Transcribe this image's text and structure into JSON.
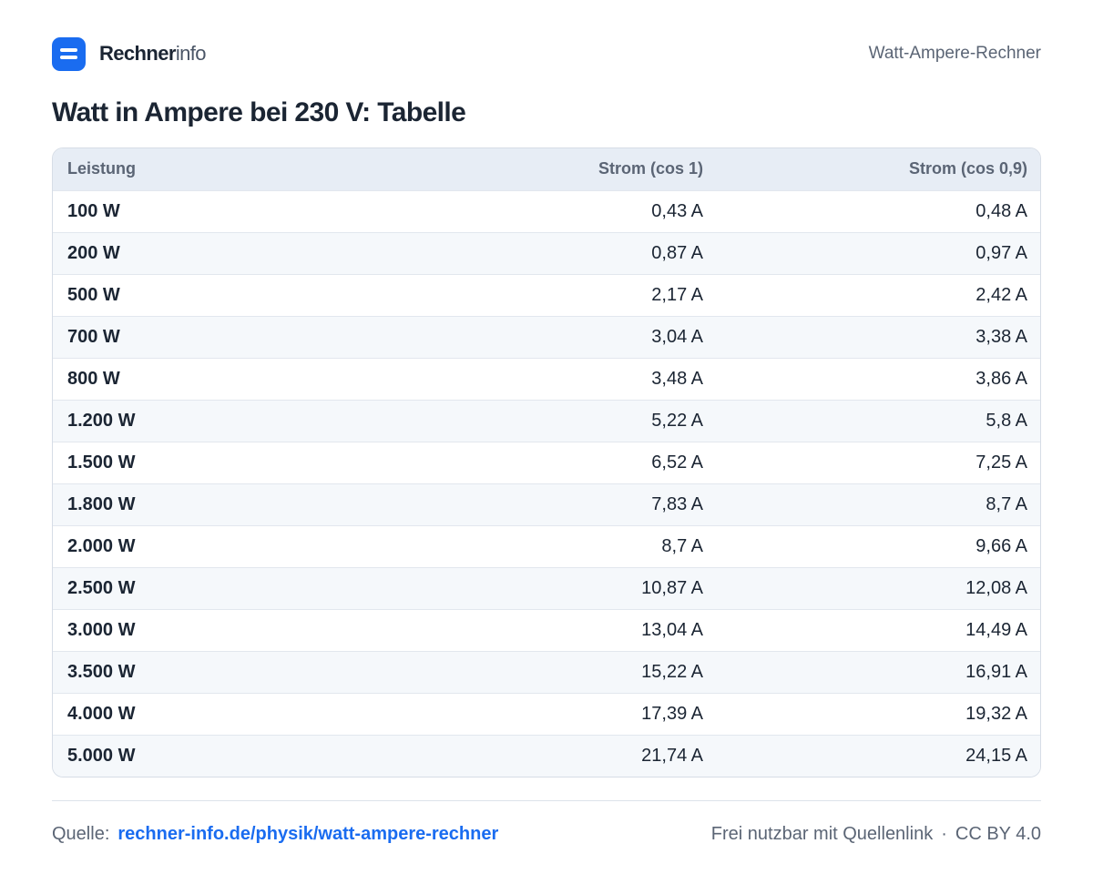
{
  "header": {
    "brand_strong": "Rechner",
    "brand_light": "info",
    "page_label": "Watt-Ampere-Rechner"
  },
  "title": "Watt in Ampere bei 230 V: Tabelle",
  "table": {
    "columns": [
      "Leistung",
      "Strom (cos  1)",
      "Strom (cos  0,9)"
    ],
    "rows": [
      [
        "100 W",
        "0,43 A",
        "0,48 A"
      ],
      [
        "200 W",
        "0,87 A",
        "0,97 A"
      ],
      [
        "500 W",
        "2,17 A",
        "2,42 A"
      ],
      [
        "700 W",
        "3,04 A",
        "3,38 A"
      ],
      [
        "800 W",
        "3,48 A",
        "3,86 A"
      ],
      [
        "1.200 W",
        "5,22 A",
        "5,8 A"
      ],
      [
        "1.500 W",
        "6,52 A",
        "7,25 A"
      ],
      [
        "1.800 W",
        "7,83 A",
        "8,7 A"
      ],
      [
        "2.000 W",
        "8,7 A",
        "9,66 A"
      ],
      [
        "2.500 W",
        "10,87 A",
        "12,08 A"
      ],
      [
        "3.000 W",
        "13,04 A",
        "14,49 A"
      ],
      [
        "3.500 W",
        "15,22 A",
        "16,91 A"
      ],
      [
        "4.000 W",
        "17,39 A",
        "19,32 A"
      ],
      [
        "5.000 W",
        "21,74 A",
        "24,15 A"
      ]
    ]
  },
  "footer": {
    "source_label": "Quelle:",
    "source_link": "rechner-info.de/physik/watt-ampere-rechner",
    "license_note": "Frei nutzbar mit Quellenlink",
    "separator": "·",
    "license": "CC BY 4.0"
  },
  "colors": {
    "accent": "#1a6cf0",
    "text": "#1b2533",
    "muted": "#5b6575",
    "header_bg": "#e7edf5",
    "stripe_bg": "#f5f8fb"
  },
  "icons": {
    "logo": "rechner-logo-icon"
  }
}
